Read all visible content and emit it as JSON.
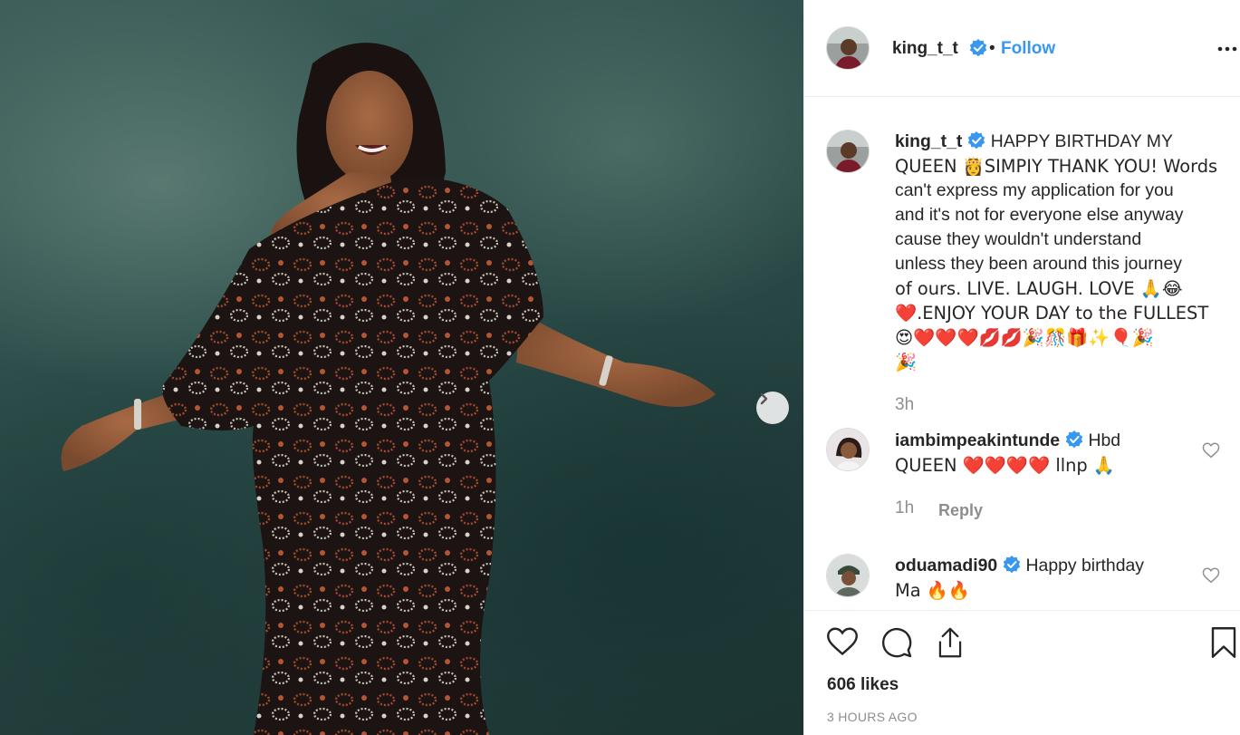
{
  "post": {
    "username": "king_t_t",
    "separator": "•",
    "follow_label": "Follow",
    "caption_lines": [
      "HAPPY BIRTHDAY MY",
      "QUEEN 👸SIMPIY THANK YOU! Words",
      "can't express my application for you",
      "and it's not for everyone else anyway",
      "cause they wouldn't understand",
      "unless they been around this journey",
      "of ours. LIVE. LAUGH. LOVE 🙏😂",
      "❤️.ENJOY YOUR DAY to the FULLEST",
      "😍❤️❤️❤️💋💋🎉🎊🎁✨🎈🎉",
      "🎉"
    ],
    "caption_age": "3h"
  },
  "comments": [
    {
      "username": "iambimpeakintunde",
      "line1": "Hbd",
      "line2": "QUEEN ❤️❤️❤️❤️ llnp 🙏",
      "age": "1h",
      "reply_label": "Reply"
    },
    {
      "username": "oduamadi90",
      "line1": "Happy birthday",
      "line2": "Ma 🔥🔥"
    }
  ],
  "footer": {
    "likes": "606 likes",
    "timestamp": "3 HOURS AGO"
  },
  "icons": {
    "like": "heart-icon",
    "comment": "comment-bubble-icon",
    "share": "share-icon",
    "save": "bookmark-icon",
    "more": "more-options-icon",
    "next": "chevron-right-icon",
    "verified": "verified-badge-icon"
  },
  "colors": {
    "accent": "#3897f0",
    "muted": "#8e8e8e",
    "text": "#262626"
  }
}
